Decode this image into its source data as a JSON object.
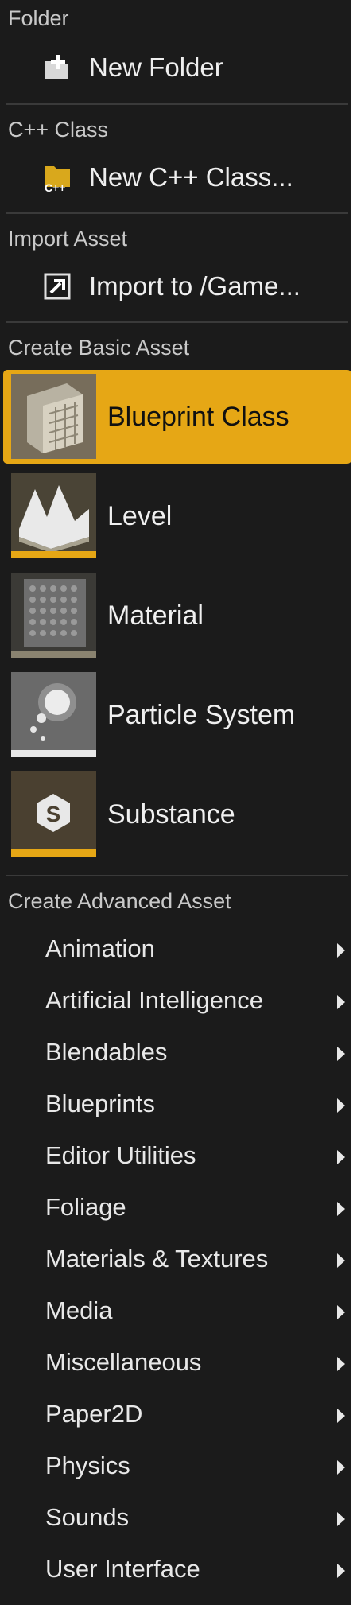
{
  "folder": {
    "header": "Folder",
    "new_folder": {
      "label": "New Folder",
      "icon": "folder-add-icon"
    }
  },
  "cpp": {
    "header": "C++ Class",
    "new_class": {
      "label": "New C++ Class...",
      "icon": "cpp-class-icon"
    }
  },
  "import": {
    "header": "Import Asset",
    "import_item": {
      "label": "Import to /Game...",
      "icon": "import-icon"
    }
  },
  "basic": {
    "header": "Create Basic Asset",
    "items": [
      {
        "label": "Blueprint Class",
        "icon": "blueprint-class-icon",
        "highlighted": true
      },
      {
        "label": "Level",
        "icon": "level-icon"
      },
      {
        "label": "Material",
        "icon": "material-icon"
      },
      {
        "label": "Particle System",
        "icon": "particle-system-icon"
      },
      {
        "label": "Substance",
        "icon": "substance-icon"
      }
    ]
  },
  "advanced": {
    "header": "Create Advanced Asset",
    "items": [
      {
        "label": "Animation"
      },
      {
        "label": "Artificial Intelligence"
      },
      {
        "label": "Blendables"
      },
      {
        "label": "Blueprints"
      },
      {
        "label": "Editor Utilities"
      },
      {
        "label": "Foliage"
      },
      {
        "label": "Materials & Textures"
      },
      {
        "label": "Media"
      },
      {
        "label": "Miscellaneous"
      },
      {
        "label": "Paper2D"
      },
      {
        "label": "Physics"
      },
      {
        "label": "Sounds"
      },
      {
        "label": "User Interface"
      }
    ]
  },
  "colors": {
    "background": "#1b1b1b",
    "highlight": "#e6a715",
    "level_bar": "#e6a715",
    "material_bar": "#8a8370",
    "particle_bar": "#e8e8e8",
    "substance_bar": "#e6a715"
  }
}
